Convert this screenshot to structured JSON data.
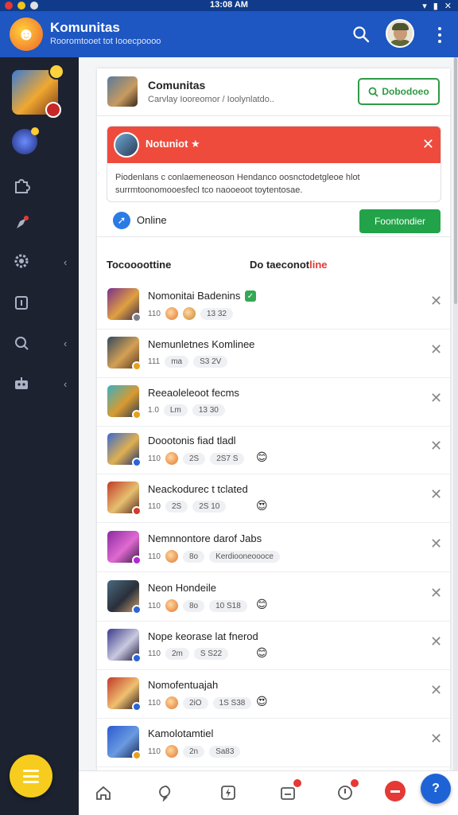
{
  "status_bar": {
    "time": "13:08 AM"
  },
  "header": {
    "title": "Komunitas",
    "subtitle": "Rooromtooet tot Iooecpoooo"
  },
  "community_card": {
    "name": "Comunitas",
    "description": "Carvlay Iooreomor / Ioolynlatdo..",
    "join_label": "Dobodoeo"
  },
  "notice": {
    "label": "Notuniot",
    "text": "Piodenlans c conlaemeneoson Hendanco oosnctodetgleoe hlot surrmtoonomooesfecl tco naooeoot toytentosae."
  },
  "online": {
    "label": "Online",
    "button_label": "Foontondier"
  },
  "list_tabs": {
    "left": "Tocoooottine",
    "right_prefix": "Do taeconot",
    "right_accent": "line"
  },
  "rows": [
    {
      "name": "Nomonitai Badenins",
      "count": "110",
      "tag": "13 32",
      "verified": true,
      "thumb_colors": [
        "#7b2f8c",
        "#e0a040",
        "#3a2a4a"
      ],
      "badge_color": "#7a7f8a",
      "faces": [
        "#e0742e",
        "#c9832f"
      ]
    },
    {
      "name": "Nemunletnes Komlinee",
      "count": "111",
      "tag": "S3 2V",
      "mid": "ma",
      "thumb_colors": [
        "#34495e",
        "#d4a055",
        "#5a3a20"
      ],
      "badge_color": "#e6a11c",
      "faces": []
    },
    {
      "name": "Reeaoleleoot fecms",
      "count": "1.0",
      "tag": "13 30",
      "mid": "Lm",
      "thumb_colors": [
        "#3ab0c0",
        "#d99a30",
        "#2a3a50"
      ],
      "badge_color": "#e6a11c",
      "faces": []
    },
    {
      "name": "Doootonis fiad tladl",
      "count": "110",
      "tag": "2S7 S",
      "mid": "2S",
      "thumb_colors": [
        "#3a6ad0",
        "#e0b050",
        "#1f2e70"
      ],
      "badge_color": "#2a66d4",
      "faces": [
        "#e0742e"
      ],
      "emoji": "😊"
    },
    {
      "name": "Neackodurec t tclated",
      "count": "110",
      "tag": "2S 10",
      "mid": "2S",
      "thumb_colors": [
        "#c23a2a",
        "#e6c070",
        "#5a2a20"
      ],
      "badge_color": "#d23a2a",
      "faces": [],
      "emoji": "😍"
    },
    {
      "name": "Nemnnontore darof Jabs",
      "count": "110",
      "tag": "Kerdiooneoooce",
      "mid": "8o",
      "thumb_colors": [
        "#8a2aa0",
        "#e06ad0",
        "#3a1a4a"
      ],
      "badge_color": "#b02ad0",
      "faces": [
        "#e0742e"
      ]
    },
    {
      "name": "Neon Hondeile",
      "count": "110",
      "tag": "10 S18",
      "mid": "8o",
      "thumb_colors": [
        "#4a6a80",
        "#2a2f3a",
        "#c9a070"
      ],
      "badge_color": "#2a66d4",
      "faces": [
        "#e0742e"
      ],
      "emoji": "😊"
    },
    {
      "name": "Nope keorase lat fnerod",
      "count": "110",
      "tag": "S S22",
      "mid": "2m",
      "thumb_colors": [
        "#3a3a8a",
        "#c9c9e0",
        "#1a1a3a"
      ],
      "badge_color": "#2a66d4",
      "faces": [],
      "emoji": "😊"
    },
    {
      "name": "Nomofentuajah",
      "count": "110",
      "tag": "1S S38",
      "mid": "2iO",
      "thumb_colors": [
        "#c0392b",
        "#f0c070",
        "#2a1a1a"
      ],
      "badge_color": "#2a66d4",
      "faces": [
        "#e0742e"
      ],
      "emoji": "😍"
    },
    {
      "name": "Kamolotamtiel",
      "count": "110",
      "tag": "Sa83",
      "mid": "2n",
      "thumb_colors": [
        "#2a5ad0",
        "#6a9ae0",
        "#1a2a5a"
      ],
      "badge_color": "#e6a11c",
      "faces": [
        "#e0742e"
      ]
    }
  ],
  "colors": {
    "header_bg": "#1e56c2",
    "sidebar_bg": "#1d2230",
    "notice_red": "#ef4b3d",
    "online_green": "#22a34a",
    "join_green": "#2e9a44",
    "fab_yellow": "#f6cc1e",
    "fab_blue": "#1e63d6"
  },
  "icons": {
    "sidebar": [
      "puzzle-icon",
      "rocket-icon",
      "gear-icon",
      "calendar-icon",
      "search-icon",
      "robot-icon"
    ],
    "bottom_nav": [
      "home-icon",
      "chat-icon",
      "lightning-icon",
      "inbox-icon",
      "notification-icon",
      "hat-icon"
    ]
  }
}
